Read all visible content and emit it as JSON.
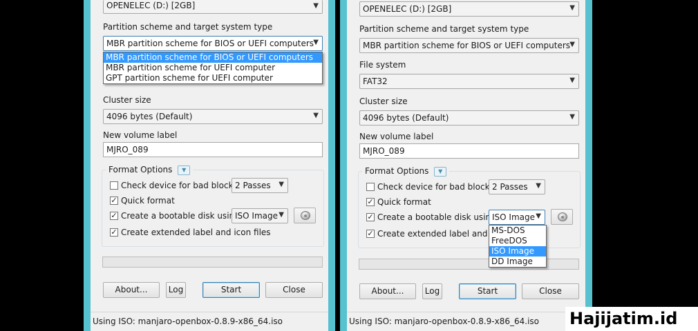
{
  "left": {
    "device_value": "OPENELEC (D:) [2GB]",
    "partition_label": "Partition scheme and target system type",
    "partition_value": "MBR partition scheme for BIOS or UEFI computers",
    "partition_options": [
      "MBR partition scheme for BIOS or UEFI computers",
      "MBR partition scheme for UEFI computer",
      "GPT partition scheme for UEFI computer"
    ],
    "cluster_label": "Cluster size",
    "cluster_value": "4096 bytes (Default)",
    "volume_label": "New volume label",
    "volume_value": "MJRO_089",
    "format_options_label": "Format Options",
    "bad_blocks_label": "Check device for bad blocks",
    "passes_value": "2 Passes",
    "quick_format_label": "Quick format",
    "bootable_label": "Create a bootable disk using",
    "image_type_value": "ISO Image",
    "extended_label": "Create extended label and icon files",
    "about_button": "About...",
    "log_button": "Log",
    "start_button": "Start",
    "close_button": "Close",
    "status_text": "Using ISO: manjaro-openbox-0.8.9-x86_64.iso"
  },
  "right": {
    "device_value": "OPENELEC (D:) [2GB]",
    "partition_label": "Partition scheme and target system type",
    "partition_value": "MBR partition scheme for BIOS or UEFI computers",
    "filesystem_label": "File system",
    "filesystem_value": "FAT32",
    "cluster_label": "Cluster size",
    "cluster_value": "4096 bytes (Default)",
    "volume_label": "New volume label",
    "volume_value": "MJRO_089",
    "format_options_label": "Format Options",
    "bad_blocks_label": "Check device for bad blocks",
    "passes_value": "2 Passes",
    "quick_format_label": "Quick format",
    "bootable_label": "Create a bootable disk using",
    "image_type_value": "ISO Image",
    "image_type_options": [
      "MS-DOS",
      "FreeDOS",
      "ISO Image",
      "DD Image"
    ],
    "extended_label": "Create extended label and ico",
    "about_button": "About...",
    "log_button": "Log",
    "start_button": "Start",
    "close_button": "Close",
    "status_text": "Using ISO: manjaro-openbox-0.8.9-x86_64.iso"
  },
  "watermark": "Hajijatim.id",
  "colors": {
    "window_frame": "#56c1cf",
    "selection": "#3399ff",
    "dialog_bg": "#f0f0f0"
  }
}
